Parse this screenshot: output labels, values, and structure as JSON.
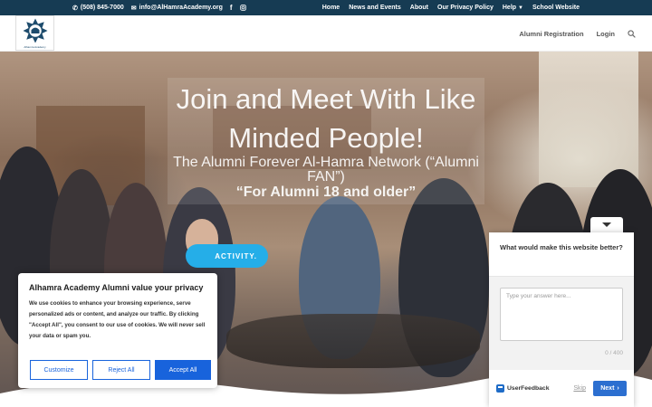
{
  "topbar": {
    "phone": "(508) 845-7000",
    "email": "info@AlHamraAcademy.org",
    "links": [
      "Home",
      "News and Events",
      "About",
      "Our Privacy Policy",
      "Help",
      "School Website"
    ]
  },
  "header": {
    "logo_text": "Alhamra Academy",
    "nav": [
      "Alumni Registration",
      "Login"
    ]
  },
  "hero": {
    "title": "Join and Meet With Like Minded People!",
    "subtitle": "The Alumni Forever Al-Hamra Network (“Alumni FAN”)",
    "subtitle2": "“For Alumni 18 and older”",
    "cta": "ACTIVITY."
  },
  "cookie": {
    "title": "Alhamra Academy Alumni value your privacy",
    "text": "We use cookies to enhance your browsing experience, serve personalized ads or content, and analyze our traffic. By clicking \"Accept All\", you consent to our use of cookies. We will never sell your data or spam you.",
    "customize": "Customize",
    "reject": "Reject All",
    "accept": "Accept All"
  },
  "feedback": {
    "question": "What would make this website better?",
    "placeholder": "Type your answer here...",
    "counter": "0 / 400",
    "brand": "UserFeedback",
    "skip": "Skip",
    "next": "Next"
  },
  "colors": {
    "topbar": "#163b53",
    "cta": "#25aee8",
    "cookie_accent": "#1863dc",
    "feedback_next": "#2c6fd0"
  }
}
